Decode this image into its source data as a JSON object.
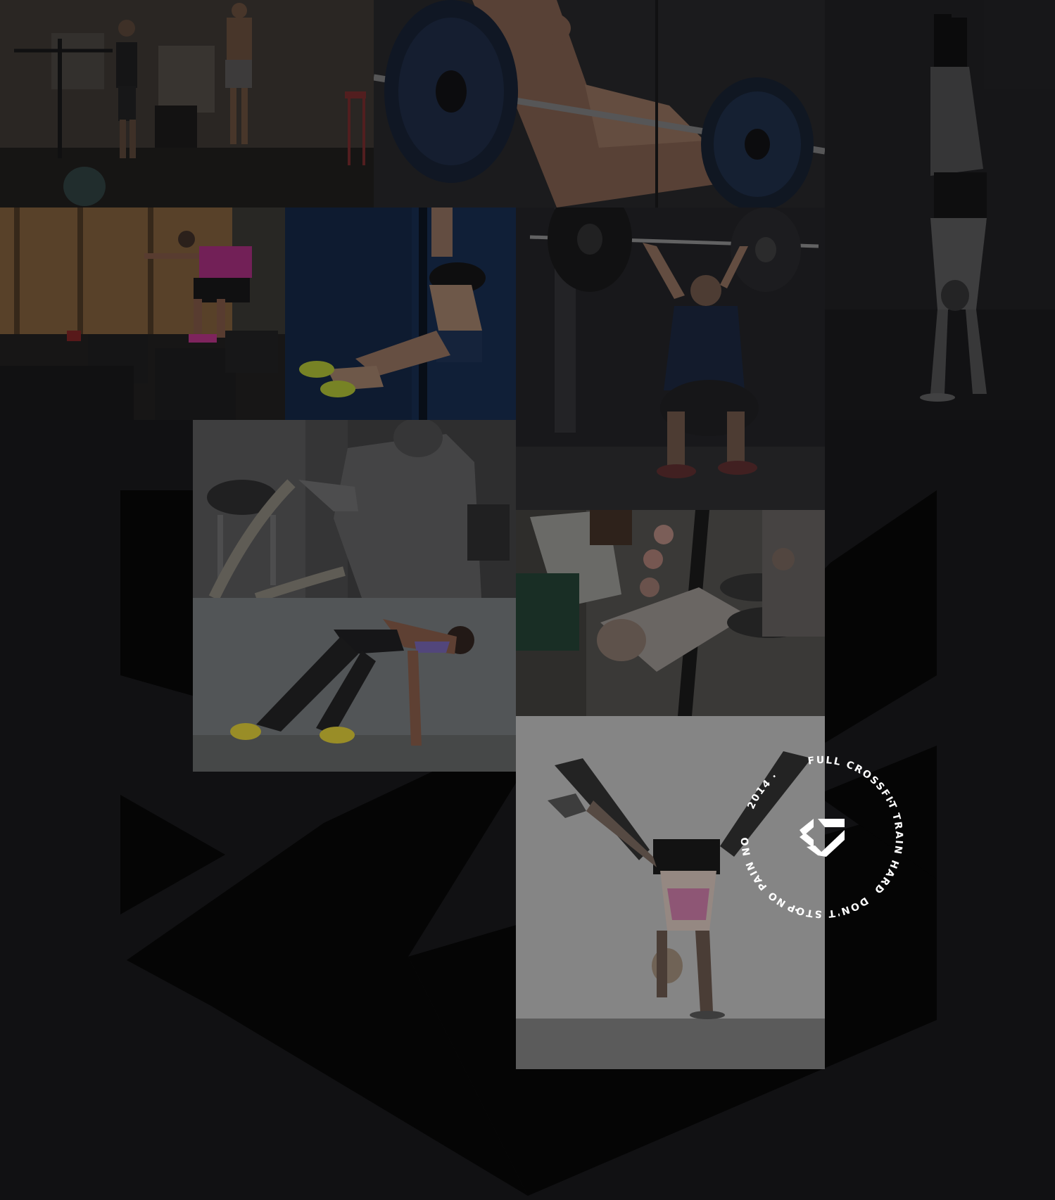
{
  "colors": {
    "page_background": "#111113",
    "shape_fill": "#050505",
    "badge_text": "#ffffff"
  },
  "badge": {
    "arc_labels": [
      "FULL CROSSFIT",
      "TRAIN HARD",
      "DON'T STOP",
      "NO PAIN NO GAIN",
      "2014"
    ],
    "separator": "·",
    "logo_icon": "chevron-logo-icon"
  },
  "gallery": {
    "tiles": [
      {
        "name": "gallery-tile-jump-rope",
        "icon": "jump-rope-photo"
      },
      {
        "name": "gallery-tile-barbell-plate",
        "icon": "barbell-plate-photo"
      },
      {
        "name": "gallery-tile-handstand-dark",
        "icon": "handstand-photo"
      },
      {
        "name": "gallery-tile-box-jump",
        "icon": "box-jump-photo"
      },
      {
        "name": "gallery-tile-rope-climb",
        "icon": "rope-climb-photo"
      },
      {
        "name": "gallery-tile-overhead-squat",
        "icon": "overhead-squat-photo"
      },
      {
        "name": "gallery-tile-battle-rope",
        "icon": "battle-rope-photo"
      },
      {
        "name": "gallery-tile-bar-hang",
        "icon": "bar-hang-photo"
      },
      {
        "name": "gallery-tile-sprint-start",
        "icon": "sprint-start-photo"
      },
      {
        "name": "gallery-tile-handstand-light",
        "icon": "handstand-light-photo"
      }
    ]
  }
}
